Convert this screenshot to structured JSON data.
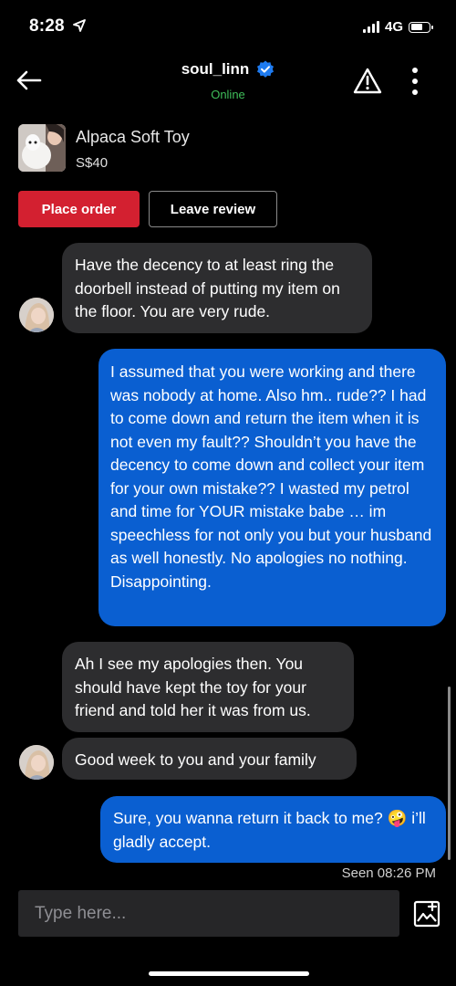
{
  "status_bar": {
    "time": "8:28",
    "network": "4G"
  },
  "header": {
    "username": "soul_linn",
    "status": "Online"
  },
  "product": {
    "name": "Alpaca Soft Toy",
    "price": "S$40"
  },
  "actions": {
    "place_order": "Place order",
    "leave_review": "Leave review"
  },
  "messages": [
    {
      "side": "in",
      "text": "Have the decency to at least ring the doorbell instead of putting my item on the floor. You are very rude."
    },
    {
      "side": "out",
      "text": "I assumed that you were working and there was nobody at home. Also hm.. rude?? I had to come down and return the item when it is not even my fault?? Shouldn’t you have the decency to come down and collect your item for your own mistake?? I wasted my petrol and time for YOUR mistake babe … im speechless for not only you but your husband as well honestly. No apologies no nothing. Disappointing."
    },
    {
      "side": "in",
      "text": "Ah I see my apologies then. You should have kept the toy for your friend and told her it was from us."
    },
    {
      "side": "in",
      "text": "Good week to you and your family"
    },
    {
      "side": "out",
      "text": "Sure, you wanna return it back to me? 🤪 i’ll gladly accept."
    }
  ],
  "seen_label": "Seen 08:26 PM",
  "composer": {
    "placeholder": "Type here..."
  },
  "colors": {
    "accent_blue": "#0a5fd1",
    "order_red": "#d32030",
    "online_green": "#3fbf5a",
    "incoming_bubble": "#2d2d2f"
  }
}
